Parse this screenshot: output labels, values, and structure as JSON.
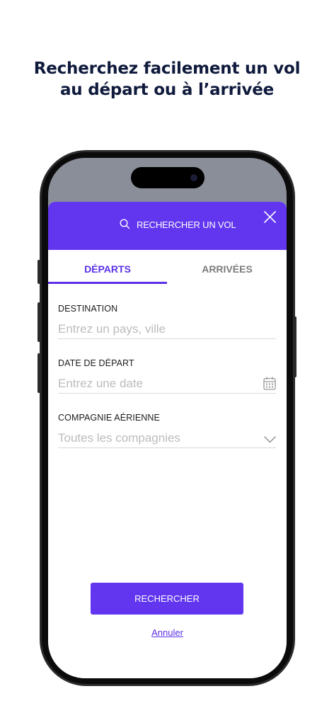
{
  "headline": {
    "line1": "Recherchez facilement un vol",
    "line2": "au départ ou à l’arrivée"
  },
  "header": {
    "title": "RECHERCHER UN VOL",
    "search_icon": "search-icon",
    "close_icon": "close-icon"
  },
  "tabs": [
    {
      "label": "DÉPARTS",
      "active": true
    },
    {
      "label": "ARRIVÉES",
      "active": false
    }
  ],
  "form": {
    "destination": {
      "label": "DESTINATION",
      "placeholder": "Entrez un pays, ville",
      "value": ""
    },
    "date": {
      "label": "DATE DE DÉPART",
      "placeholder": "Entrez une date",
      "value": "",
      "icon": "calendar-icon"
    },
    "airline": {
      "label": "COMPAGNIE AÉRIENNE",
      "placeholder": "Toutes les compagnies",
      "value": "",
      "icon": "chevron-down-icon"
    }
  },
  "actions": {
    "search_label": "RECHERCHER",
    "cancel_label": "Annuler"
  },
  "colors": {
    "accent": "#6236EF",
    "headline": "#0F1A3C",
    "placeholder": "#BCBCBC",
    "inactive_tab": "#7B7B7B"
  }
}
